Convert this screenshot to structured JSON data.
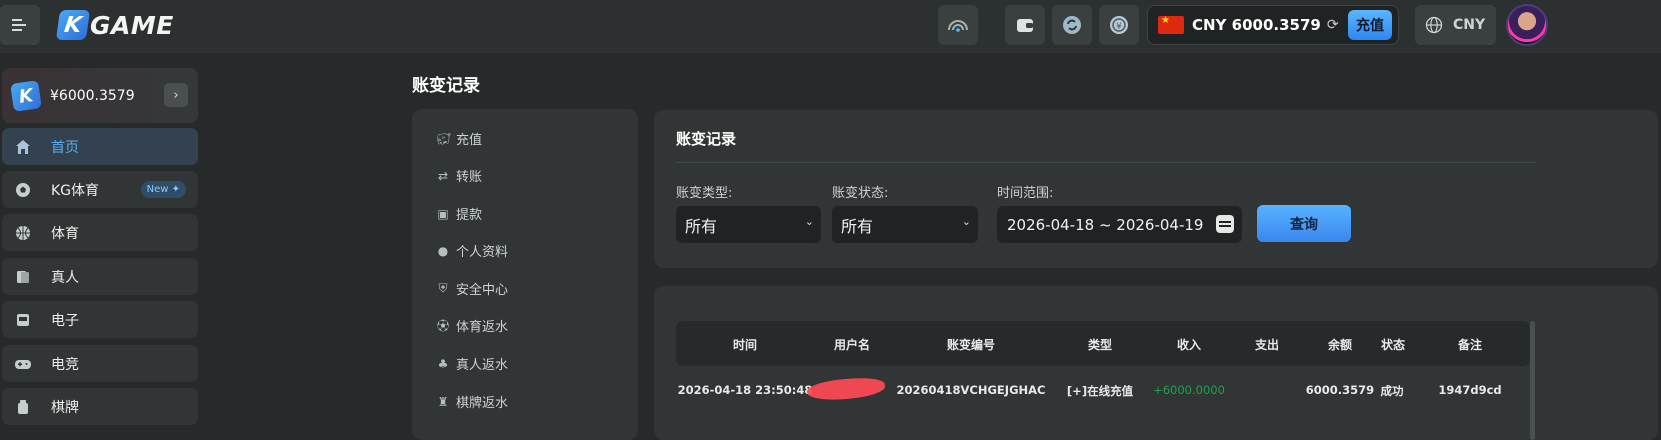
{
  "app": {
    "logo_k": "K",
    "logo_text": "GAME"
  },
  "header": {
    "currency_balance": "CNY 6000.3579",
    "recharge_label": "充值",
    "currency_code": "CNY"
  },
  "sidebar": {
    "wallet_amount": "¥6000.3579",
    "items": [
      {
        "label": "首页",
        "icon": "home-icon"
      },
      {
        "label": "KG体育",
        "icon": "soccer-ball-icon",
        "badge": "New ✦"
      },
      {
        "label": "体育",
        "icon": "basketball-icon"
      },
      {
        "label": "真人",
        "icon": "cards-icon"
      },
      {
        "label": "电子",
        "icon": "slot-machine-icon"
      },
      {
        "label": "电竞",
        "icon": "gamepad-icon"
      },
      {
        "label": "棋牌",
        "icon": "chess-icon"
      }
    ]
  },
  "page": {
    "title": "账变记录"
  },
  "submenu": {
    "items": [
      {
        "label": "充值",
        "icon": "piggy-bank-icon"
      },
      {
        "label": "转账",
        "icon": "transfer-icon"
      },
      {
        "label": "提款",
        "icon": "withdraw-icon"
      },
      {
        "label": "个人资料",
        "icon": "user-icon"
      },
      {
        "label": "安全中心",
        "icon": "shield-icon"
      },
      {
        "label": "体育返水",
        "icon": "soccer-ball-icon"
      },
      {
        "label": "真人返水",
        "icon": "poker-chips-icon"
      },
      {
        "label": "棋牌返水",
        "icon": "chess-icon"
      }
    ]
  },
  "filter": {
    "title": "账变记录",
    "type_label": "账变类型:",
    "type_value": "所有",
    "status_label": "账变状态:",
    "status_value": "所有",
    "range_label": "时间范围:",
    "range_value": "2026-04-18 ~ 2026-04-19",
    "query_label": "查询"
  },
  "table": {
    "headers": [
      "时间",
      "用户名",
      "账变编号",
      "类型",
      "收入",
      "支出",
      "余额",
      "状态",
      "备注"
    ],
    "rows": [
      {
        "time": "2026-04-18 23:50:48",
        "username": "",
        "id": "20260418VCHGEJGHAC",
        "type": "[+]在线充值",
        "income": "+6000.0000",
        "expense": "",
        "balance": "6000.3579",
        "status": "成功",
        "note": "1947d9cd"
      }
    ]
  },
  "colors": {
    "accent": "#3a86ee",
    "income_green": "#1fa24a",
    "background": "#262a2b",
    "panel": "#313535"
  }
}
